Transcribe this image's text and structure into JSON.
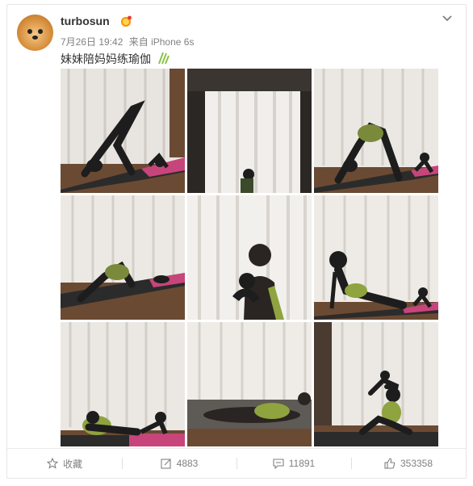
{
  "post": {
    "username": "turbosun",
    "date": "7月26日 19:42",
    "source": "来自 iPhone 6s",
    "text": "妹妹陪妈妈练瑜伽",
    "vip_icon": "vip-badge-icon",
    "emoji_icon": "sparkle-emoji-icon"
  },
  "photos": [
    {
      "name": "yoga-photo-1"
    },
    {
      "name": "yoga-photo-2"
    },
    {
      "name": "yoga-photo-3"
    },
    {
      "name": "yoga-photo-4"
    },
    {
      "name": "yoga-photo-5"
    },
    {
      "name": "yoga-photo-6"
    },
    {
      "name": "yoga-photo-7"
    },
    {
      "name": "yoga-photo-8"
    },
    {
      "name": "yoga-photo-9"
    }
  ],
  "actions": {
    "favorite_label": "收藏",
    "repost_count": "4883",
    "comment_count": "11891",
    "like_count": "353358"
  },
  "colors": {
    "text": "#333333",
    "meta": "#808080",
    "mat_pink": "#c7457a",
    "mat_dark": "#2b2b2b",
    "floor": "#6b4a33"
  }
}
